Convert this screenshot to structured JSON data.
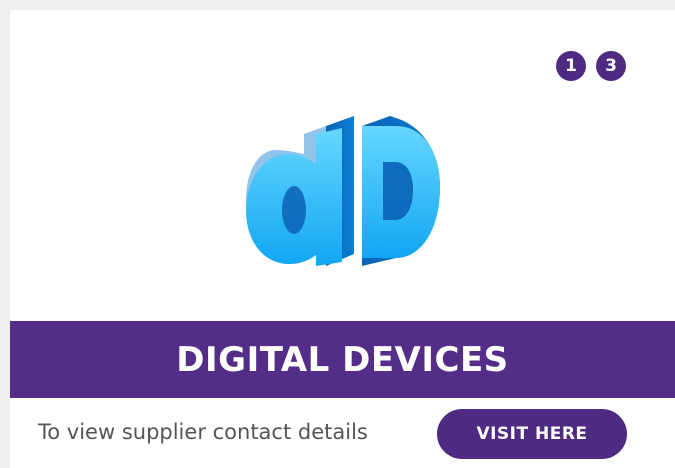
{
  "badges": [
    {
      "label": "1"
    },
    {
      "label": "3"
    }
  ],
  "logo": {
    "icon": "digital-devices-logo",
    "text": "dD",
    "colors": {
      "light": "#39c3ff",
      "mid": "#12a6f2",
      "dark": "#0a62b7"
    }
  },
  "banner": {
    "title": "DIGITAL DEVICES",
    "color": "#532d87"
  },
  "footer": {
    "description": "To view supplier contact details",
    "button_label": "VISIT HERE",
    "button_color": "#4f2a82"
  }
}
